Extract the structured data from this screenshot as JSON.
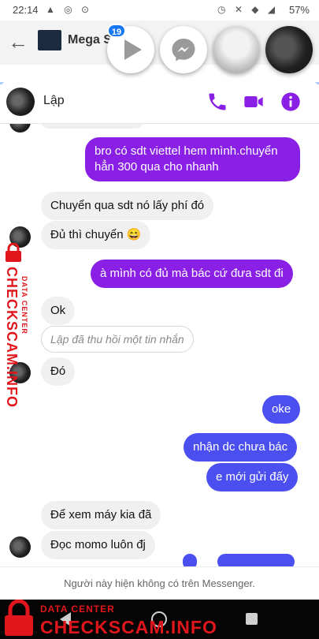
{
  "status_bar": {
    "time": "22:14",
    "battery": "57%"
  },
  "app_header": {
    "title": "Mega S"
  },
  "chat_heads": {
    "badge_count": "19"
  },
  "chat": {
    "contact_name": "Lập",
    "messages": [
      {
        "text": "bro có sdt viettel hem mình.chuyển hẳn 300 qua cho nhanh"
      },
      {
        "text": "Chuyển qua sdt nó lấy phí đó"
      },
      {
        "text": "Đủ thì chuyển 😄"
      },
      {
        "text": "à mình có đủ mà bác cứ đưa sdt đi"
      },
      {
        "text": "Ok"
      },
      {
        "text": "Lập đã thu hồi một tin nhắn"
      },
      {
        "text": "Đó"
      },
      {
        "text": "oke"
      },
      {
        "text": "nhận dc chưa bác"
      },
      {
        "text": "e mới gửi đấy"
      },
      {
        "text": "Để xem máy kia đã"
      },
      {
        "text": "Đọc momo luôn đj"
      }
    ],
    "footer_note": "Người này hiện không có trên Messenger."
  },
  "watermark": {
    "main": "CHECKSCAM.INFO",
    "sub": "DATA CENTER"
  },
  "colors": {
    "purple_bubble": "#8a1fe6",
    "blue_bubble": "#4c4ff0",
    "accent": "#8a1fe6",
    "watermark": "#e0161c"
  },
  "icons": [
    "back-arrow-icon",
    "play-icon",
    "messenger-icon",
    "phone-icon",
    "video-camera-icon",
    "info-icon",
    "lock-icon"
  ]
}
